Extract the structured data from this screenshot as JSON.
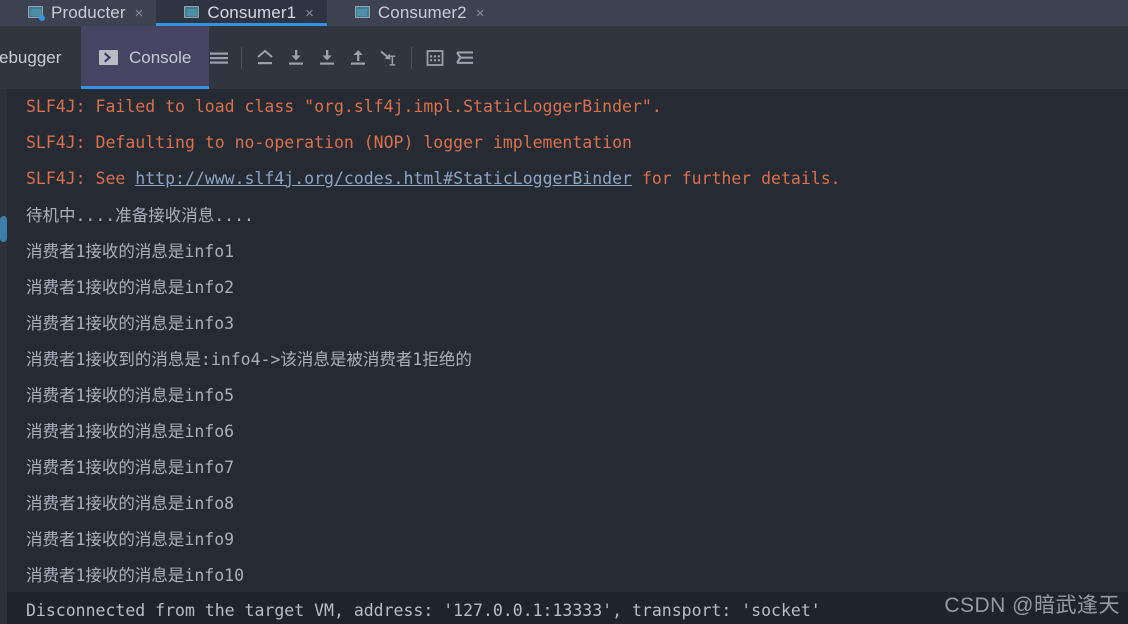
{
  "window": {
    "tabs": [
      {
        "label": "Producter",
        "icon": "monitor-icon",
        "active": false,
        "running": true,
        "close": "×"
      },
      {
        "label": "Consumer1",
        "icon": "monitor-icon",
        "active": true,
        "running": false,
        "close": "×"
      },
      {
        "label": "Consumer2",
        "icon": "monitor-icon",
        "active": false,
        "running": false,
        "close": "×"
      }
    ]
  },
  "toolwindow": {
    "debugger_tab": "ebugger",
    "console_tab": "Console",
    "console_icon": "console-chevron-icon",
    "toolbar": [
      {
        "name": "soft-wrap-lines-icon",
        "title": "Soft-Wrap"
      },
      {
        "name": "step-over-icon",
        "title": "Step Over"
      },
      {
        "name": "step-into-icon",
        "title": "Step Into"
      },
      {
        "name": "force-step-into-icon",
        "title": "Force Step Into"
      },
      {
        "name": "step-out-icon",
        "title": "Step Out"
      },
      {
        "name": "run-to-cursor-icon",
        "title": "Run to Cursor"
      },
      {
        "name": "evaluate-expression-icon",
        "title": "Evaluate Expression"
      },
      {
        "name": "settings-sliders-icon",
        "title": "Settings"
      }
    ]
  },
  "colors": {
    "tabstrip_bg": "#3c4250",
    "toolbar_bg": "#313540",
    "console_bg": "#262b33",
    "accent_blue": "#3592e8",
    "selected_tab_bg": "#464463",
    "error_text": "#d9704e",
    "normal_text": "#a9b0bd",
    "link_text": "#8da3c4"
  },
  "console": {
    "lines": [
      {
        "id": 1,
        "kind": "err",
        "text": "SLF4J: Failed to load class \"org.slf4j.impl.StaticLoggerBinder\"."
      },
      {
        "id": 2,
        "kind": "err",
        "text": "SLF4J: Defaulting to no-operation (NOP) logger implementation"
      },
      {
        "id": 3,
        "kind": "err-link",
        "pre": "SLF4J: See ",
        "link": "http://www.slf4j.org/codes.html#StaticLoggerBinder",
        "post": " for further details."
      },
      {
        "id": 4,
        "kind": "cn",
        "text": "待机中....准备接收消息...."
      },
      {
        "id": 5,
        "kind": "cn",
        "text": "消费者1接收的消息是info1"
      },
      {
        "id": 6,
        "kind": "cn",
        "text": "消费者1接收的消息是info2"
      },
      {
        "id": 7,
        "kind": "cn",
        "text": "消费者1接收的消息是info3"
      },
      {
        "id": 8,
        "kind": "cn",
        "text": "消费者1接收到的消息是:info4->该消息是被消费者1拒绝的"
      },
      {
        "id": 9,
        "kind": "cn",
        "text": "消费者1接收的消息是info5"
      },
      {
        "id": 10,
        "kind": "cn",
        "text": "消费者1接收的消息是info6"
      },
      {
        "id": 11,
        "kind": "cn",
        "text": "消费者1接收的消息是info7"
      },
      {
        "id": 12,
        "kind": "cn",
        "text": "消费者1接收的消息是info8"
      },
      {
        "id": 13,
        "kind": "cn",
        "text": "消费者1接收的消息是info9"
      },
      {
        "id": 14,
        "kind": "cn",
        "text": "消费者1接收的消息是info10"
      },
      {
        "id": 15,
        "kind": "highlight",
        "text": "Disconnected from the target VM, address: '127.0.0.1:13333', transport: 'socket'"
      }
    ]
  },
  "watermark": {
    "text": "CSDN @暗武逢天"
  }
}
